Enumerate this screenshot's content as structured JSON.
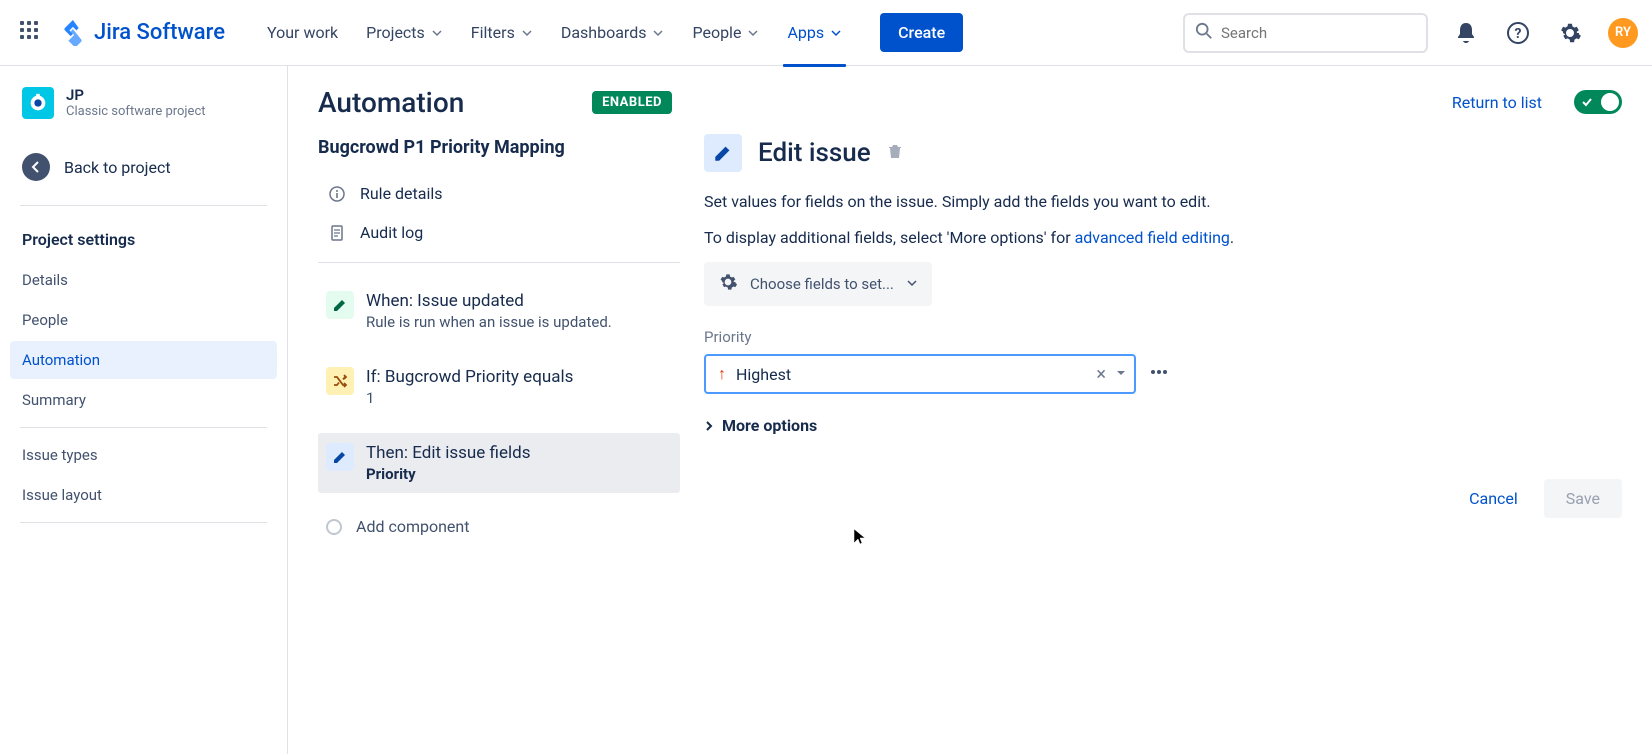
{
  "topnav": {
    "brand": "Jira Software",
    "items": [
      "Your work",
      "Projects",
      "Filters",
      "Dashboards",
      "People",
      "Apps"
    ],
    "create": "Create",
    "search_placeholder": "Search",
    "avatar": "RY"
  },
  "sidebar": {
    "project_key": "JP",
    "project_sub": "Classic software project",
    "back": "Back to project",
    "heading": "Project settings",
    "links": [
      "Details",
      "People",
      "Automation",
      "Summary"
    ],
    "active_index": 2,
    "bottom_links": [
      "Issue types",
      "Issue layout"
    ]
  },
  "header": {
    "title": "Automation",
    "badge": "ENABLED",
    "return": "Return to list"
  },
  "rule": {
    "name": "Bugcrowd P1 Priority Mapping",
    "details": "Rule details",
    "audit": "Audit log",
    "trigger_title": "When: Issue updated",
    "trigger_sub": "Rule is run when an issue is updated.",
    "cond_title": "If: Bugcrowd Priority equals",
    "cond_sub": "1",
    "action_title": "Then: Edit issue fields",
    "action_sub": "Priority",
    "add_component": "Add component"
  },
  "panel": {
    "title": "Edit issue",
    "desc1": "Set values for fields on the issue. Simply add the fields you want to edit.",
    "desc2a": "To display additional fields, select 'More options' for ",
    "desc2_link": "advanced field editing",
    "choose": "Choose fields to set...",
    "field_label": "Priority",
    "field_value": "Highest",
    "more_options": "More options",
    "cancel": "Cancel",
    "save": "Save"
  }
}
